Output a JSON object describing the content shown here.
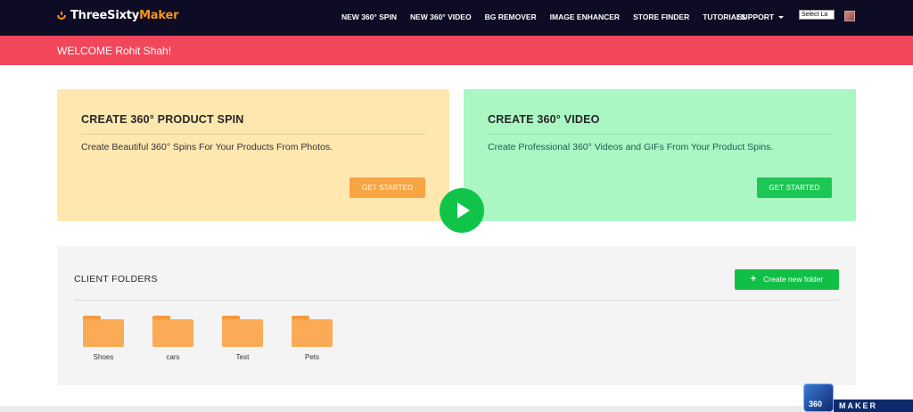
{
  "nav": {
    "logo_main": "ThreeSixty",
    "logo_accent": "Maker",
    "links": [
      "NEW 360° SPIN",
      "NEW 360° VIDEO",
      "BG REMOVER",
      "IMAGE ENHANCER",
      "STORE FINDER",
      "TUTORIALS"
    ],
    "support": "SUPPORT",
    "language_select": "Select La"
  },
  "welcome": "WELCOME Rohit Shah!",
  "cards": {
    "spin": {
      "title": "CREATE 360° PRODUCT SPIN",
      "description": "Create Beautiful 360° Spins For Your Products From Photos.",
      "button": "GET STARTED"
    },
    "video": {
      "title": "CREATE 360° VIDEO",
      "description": "Create Professional 360° Videos and GIFs From Your Product Spins.",
      "button": "GET STARTED"
    }
  },
  "folders": {
    "title": "CLIENT FOLDERS",
    "new_button": "Create new folder",
    "items": [
      "Shoes",
      "cars",
      "Test",
      "Pets"
    ]
  },
  "badge": {
    "cube": "360",
    "label": "MAKER"
  },
  "colors": {
    "navbar": "#0d0c24",
    "welcome_bar": "#f2475a",
    "spin_card": "#ffe7b0",
    "video_card": "#aaf7c4",
    "accent_orange": "#f7a443",
    "accent_green": "#1dc755"
  }
}
